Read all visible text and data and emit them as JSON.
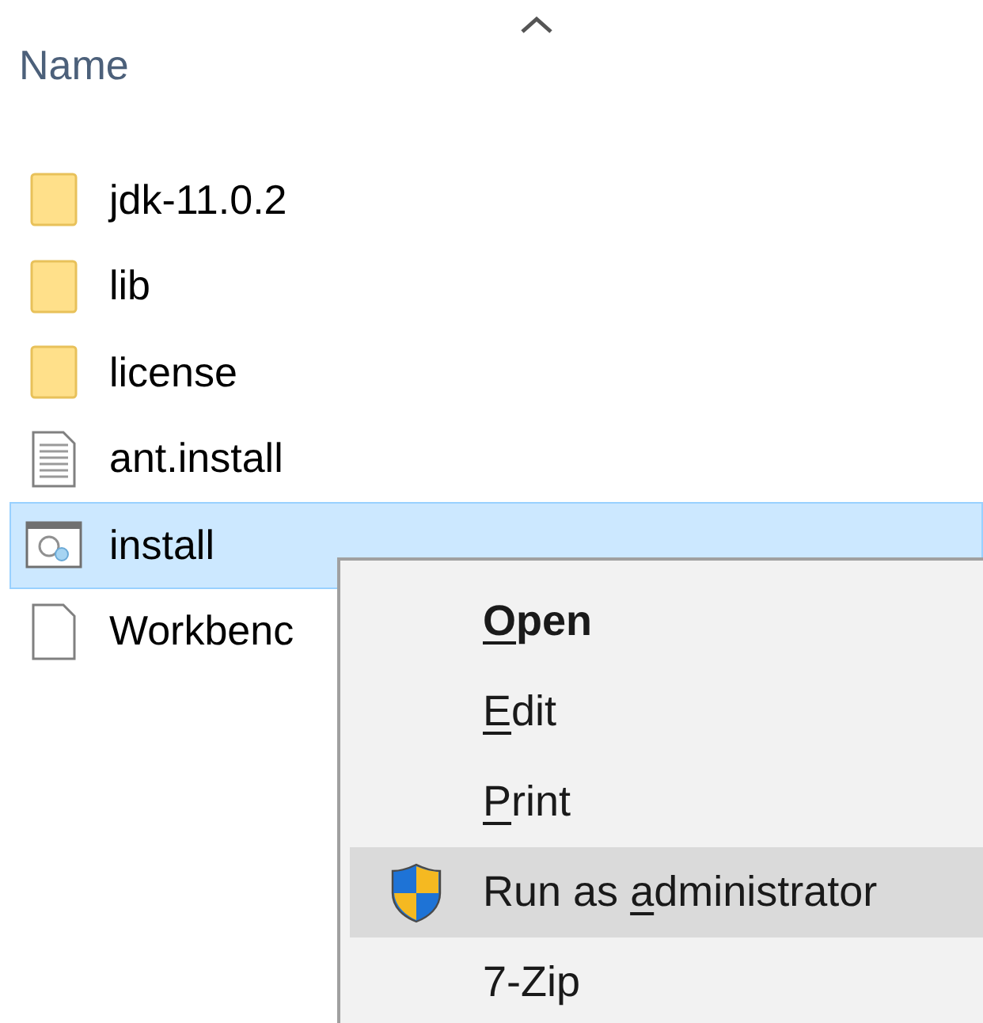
{
  "column_header": {
    "label": "Name",
    "sorted_ascending": true
  },
  "files": [
    {
      "name": "jdk-11.0.2",
      "kind": "folder",
      "selected": false
    },
    {
      "name": "lib",
      "kind": "folder",
      "selected": false
    },
    {
      "name": "license",
      "kind": "folder",
      "selected": false
    },
    {
      "name": "ant.install",
      "kind": "text",
      "selected": false
    },
    {
      "name": "install",
      "kind": "script",
      "selected": true
    },
    {
      "name": "Workbenc",
      "kind": "blank",
      "selected": false
    }
  ],
  "context_menu": [
    {
      "key": "O",
      "after": "pen",
      "default": true,
      "highlighted": false,
      "kind": "plain"
    },
    {
      "key": "E",
      "after": "dit",
      "default": false,
      "highlighted": false,
      "kind": "plain"
    },
    {
      "key": "P",
      "after": "rint",
      "default": false,
      "highlighted": false,
      "kind": "plain"
    },
    {
      "before": "Run as ",
      "key": "a",
      "after": "dministrator",
      "default": false,
      "highlighted": true,
      "kind": "admin"
    },
    {
      "before": "7-Zip",
      "default": false,
      "highlighted": false,
      "kind": "plain"
    }
  ]
}
